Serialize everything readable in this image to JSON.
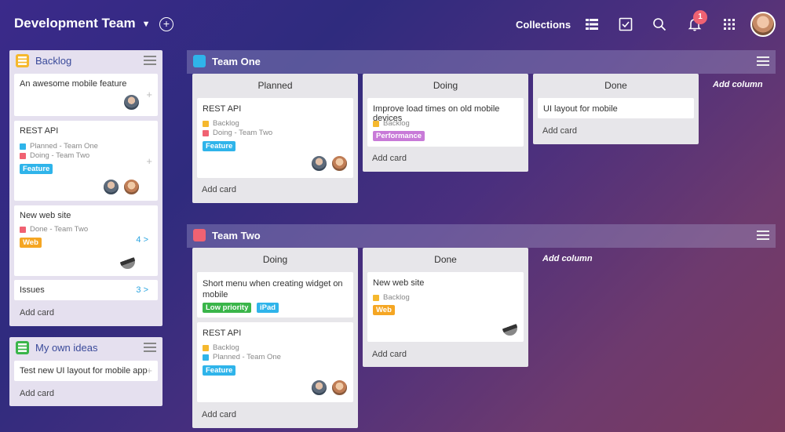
{
  "topbar": {
    "team_name": "Development Team",
    "collections_label": "Collections",
    "notification_count": "1",
    "plus_symbol": "+",
    "chevron": "⌄"
  },
  "sidebar": {
    "backlog": {
      "title": "Backlog",
      "cards": [
        {
          "title": "An awesome mobile feature"
        },
        {
          "title": "REST API",
          "meta": [
            "Planned - Team One",
            "Doing - Team Two"
          ],
          "tag": "Feature"
        },
        {
          "title": "New web site",
          "meta": [
            "Done - Team Two"
          ],
          "tag": "Web",
          "count": "4 >"
        },
        {
          "title": "Issues",
          "count": "3 >"
        }
      ],
      "add_card": "Add card"
    },
    "own_ideas": {
      "title": "My own ideas",
      "cards": [
        {
          "title": "Test new UI layout for mobile app"
        }
      ],
      "add_card": "Add card"
    }
  },
  "team_one": {
    "title": "Team One",
    "add_column": "Add column",
    "columns": [
      {
        "title": "Planned",
        "cards": [
          {
            "title": "REST API",
            "meta": [
              "Backlog",
              "Doing - Team Two"
            ],
            "tag": "Feature"
          }
        ],
        "add_card": "Add card"
      },
      {
        "title": "Doing",
        "cards": [
          {
            "title": "Improve load times on old mobile devices",
            "meta": [
              "Backlog"
            ],
            "tag": "Performance"
          }
        ],
        "add_card": "Add card"
      },
      {
        "title": "Done",
        "cards": [
          {
            "title": "UI layout for mobile"
          }
        ],
        "add_card": "Add card"
      }
    ]
  },
  "team_two": {
    "title": "Team Two",
    "add_column": "Add column",
    "columns": [
      {
        "title": "Doing",
        "cards": [
          {
            "title": "Short menu when creating widget on mobile",
            "tags": [
              "Low priority",
              "iPad"
            ]
          },
          {
            "title": "REST API",
            "meta": [
              "Backlog",
              "Planned - Team One"
            ],
            "tag": "Feature"
          }
        ],
        "add_card": "Add card"
      },
      {
        "title": "Done",
        "cards": [
          {
            "title": "New web site",
            "meta": [
              "Backlog"
            ],
            "tag": "Web"
          }
        ],
        "add_card": "Add card"
      }
    ]
  },
  "colors": {
    "feature": "#2fb4ea",
    "web": "#f5a623",
    "performance": "#c87ad8",
    "low_priority": "#3ab54a",
    "ipad": "#2fb4ea",
    "backlog_sq": "#f5b82e",
    "planned_sq": "#2fb4ea",
    "doing_sq": "#f06272",
    "done_sq": "#f06272"
  },
  "icons": [
    "chevron-down-icon",
    "add-circle-icon",
    "list-view-icon",
    "checkbox-icon",
    "search-icon",
    "bell-icon",
    "apps-grid-icon",
    "user-avatar",
    "menu-icon",
    "board-icon",
    "widget-list-icon"
  ]
}
